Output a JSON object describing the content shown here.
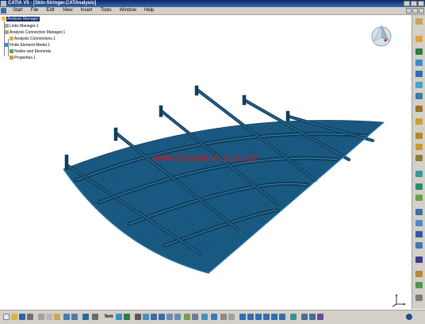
{
  "window": {
    "title": "CATIA V5 - [Skin-Stringer.CATAnalysis]"
  },
  "menu": {
    "items": [
      "Start",
      "File",
      "Edit",
      "View",
      "Insert",
      "Tools",
      "Window",
      "Help"
    ]
  },
  "tree": {
    "nodes": [
      "Analysis Manager",
      "Links Manager.1",
      "Analysis Connection Manager.1",
      "Analysis Connections.1",
      "Finite Element Model.1",
      "Nodes and Elements",
      "Properties.1"
    ]
  },
  "viewport": {
    "watermark": "www.fevonline.com.cn",
    "model_color": "#1c5f8a",
    "mesh_color": "#0b2e45"
  },
  "toolbar": {
    "fem_label": "fem"
  },
  "colors": {
    "title_bar": "#0a246a",
    "toolbar_bg": "#d4d0c8",
    "selection": "#0a246a"
  }
}
